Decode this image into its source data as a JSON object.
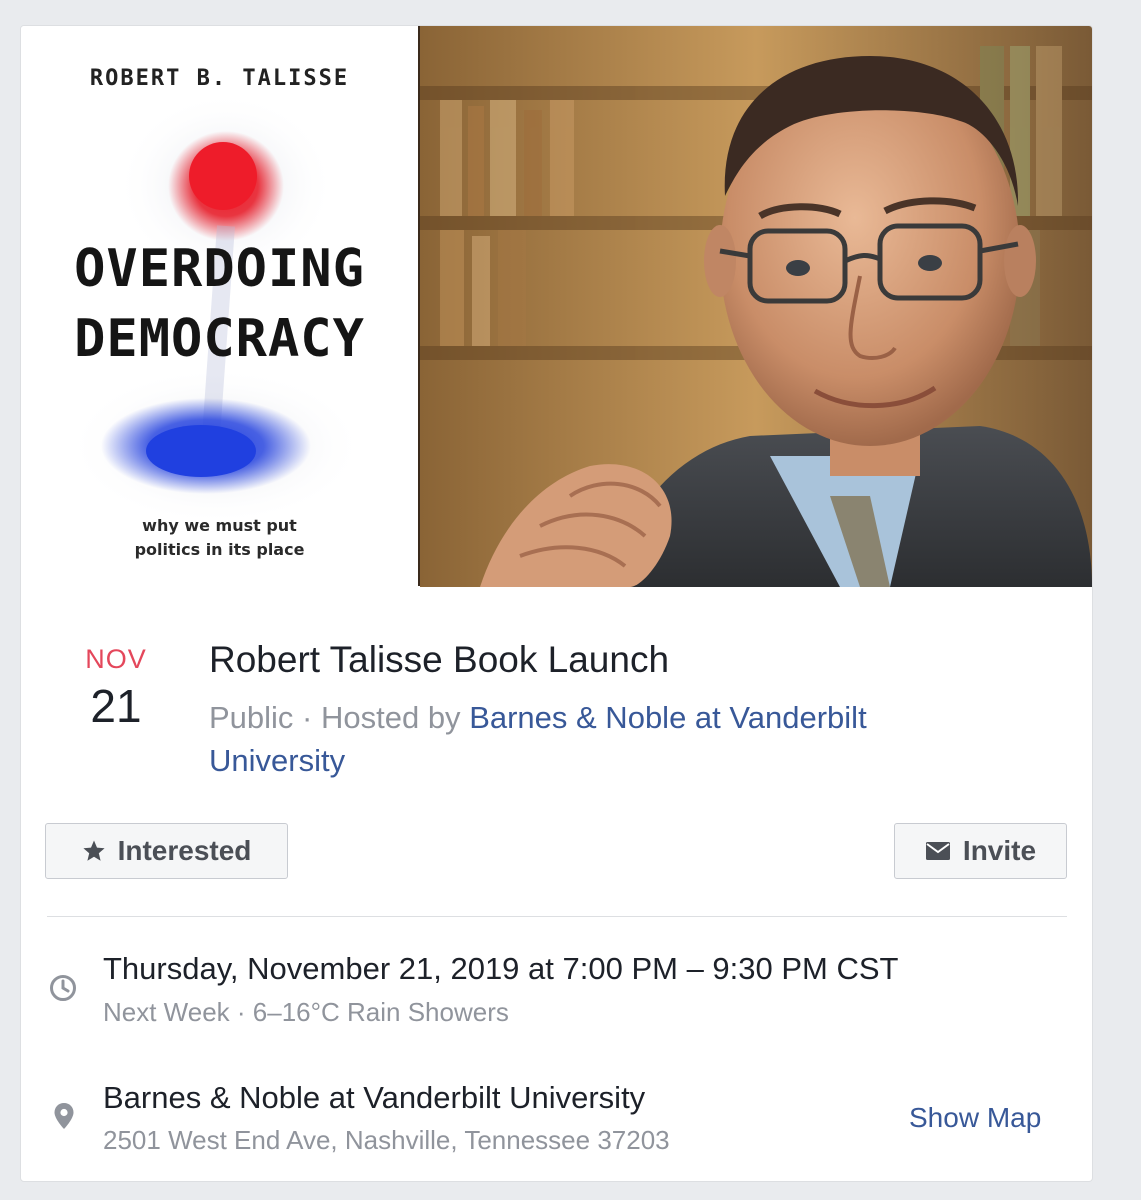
{
  "book": {
    "author": "ROBERT B. TALISSE",
    "title_line1": "OVERDOING",
    "title_line2": "DEMOCRACY",
    "subtitle_line1": "why we must put",
    "subtitle_line2": "politics in its place"
  },
  "event": {
    "month": "NOV",
    "day": "21",
    "title": "Robert Talisse Book Launch",
    "privacy": "Public",
    "hosted_by_prefix": " · Hosted by ",
    "host": "Barnes & Noble at Vanderbilt University"
  },
  "actions": {
    "interested_label": "Interested",
    "interested_icon": "star-icon",
    "invite_label": "Invite",
    "invite_icon": "envelope-icon"
  },
  "details": {
    "time_icon": "clock-icon",
    "datetime": "Thursday, November 21, 2019 at 7:00 PM – 9:30 PM CST",
    "relative_weather": "Next Week · 6–16°C Rain Showers",
    "location_icon": "map-pin-icon",
    "location_name": "Barnes & Noble at Vanderbilt University",
    "address": "2501 West End Ave, Nashville, Tennessee 37203",
    "show_map_label": "Show Map"
  },
  "colors": {
    "month_red": "#e4475b",
    "link_blue": "#385898",
    "muted_gray": "#90949c",
    "text_dark": "#1d2129"
  }
}
